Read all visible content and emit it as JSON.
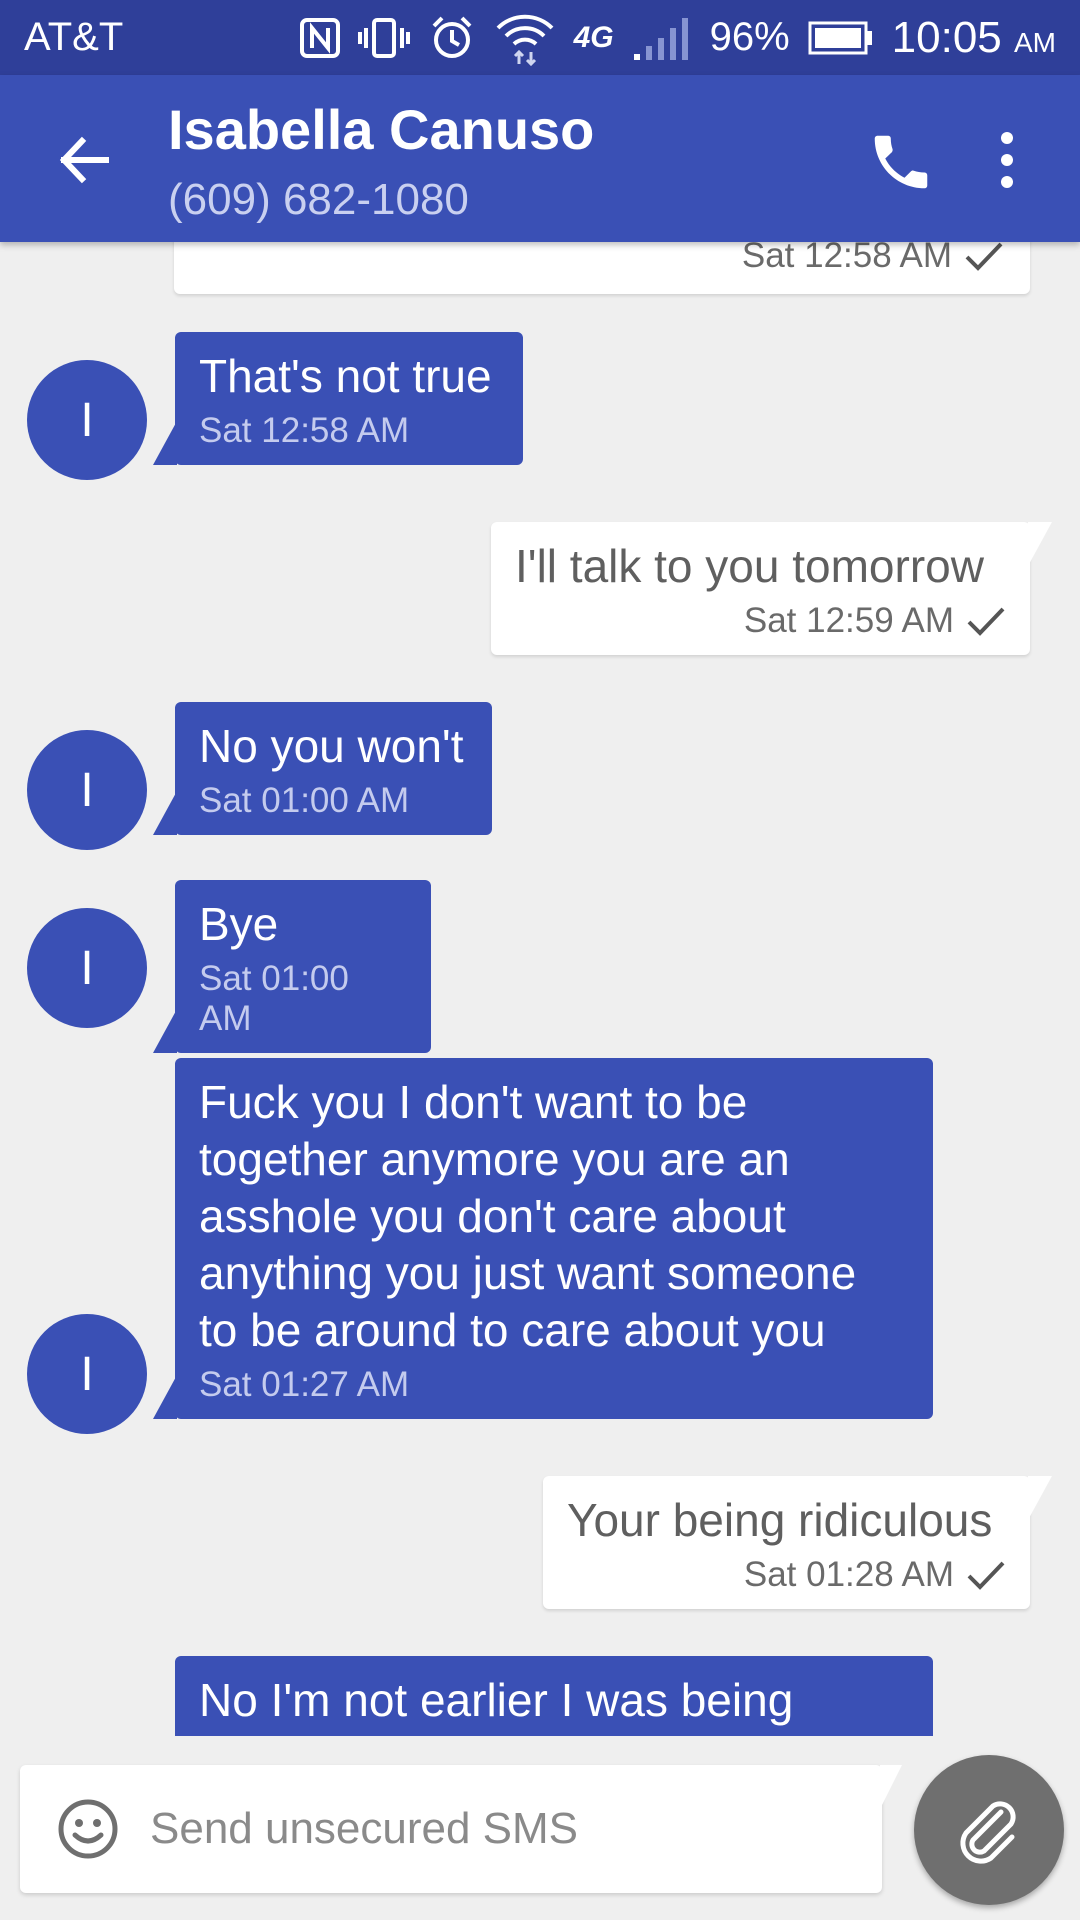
{
  "status_bar": {
    "carrier": "AT&T",
    "network": "4G",
    "battery": "96%",
    "time": "10:05",
    "ampm": "AM"
  },
  "header": {
    "name": "Isabella Canuso",
    "number": "(609) 682-1080"
  },
  "avatar_letter": "I",
  "messages": [
    {
      "dir": "out",
      "text": "",
      "time": "Sat 12:58 AM"
    },
    {
      "dir": "in",
      "text": "That's not true",
      "time": "Sat 12:58 AM"
    },
    {
      "dir": "out",
      "text": "I'll talk to you tomorrow",
      "time": "Sat 12:59 AM"
    },
    {
      "dir": "in",
      "text": "No you won't",
      "time": "Sat 01:00 AM"
    },
    {
      "dir": "in",
      "text": "Bye",
      "time": "Sat 01:00 AM"
    },
    {
      "dir": "in",
      "lines": [
        "Fuck you I don't want to be",
        "together anymore you are an",
        "asshole you don't care about",
        "anything you just want someone",
        "to be around to care about you"
      ],
      "time": "Sat 01:27 AM"
    },
    {
      "dir": "out",
      "text": "Your being ridiculous",
      "time": "Sat 01:28 AM"
    },
    {
      "dir": "in",
      "text": "No I'm not earlier I was being",
      "time": ""
    }
  ],
  "composer": {
    "placeholder": "Send unsecured SMS"
  },
  "icons": {
    "back": "arrow-back-icon",
    "call": "phone-icon",
    "more": "more-vert-icon",
    "emoji": "emoji-icon",
    "attach": "paperclip-icon",
    "delivered": "check-icon"
  },
  "colors": {
    "status_bar": "#2f3f99",
    "app_bar": "#3a50b5",
    "incoming_bubble": "#3a50b5",
    "outgoing_bubble": "#ffffff",
    "background": "#efefef",
    "attach_button": "#6f6f6f"
  }
}
